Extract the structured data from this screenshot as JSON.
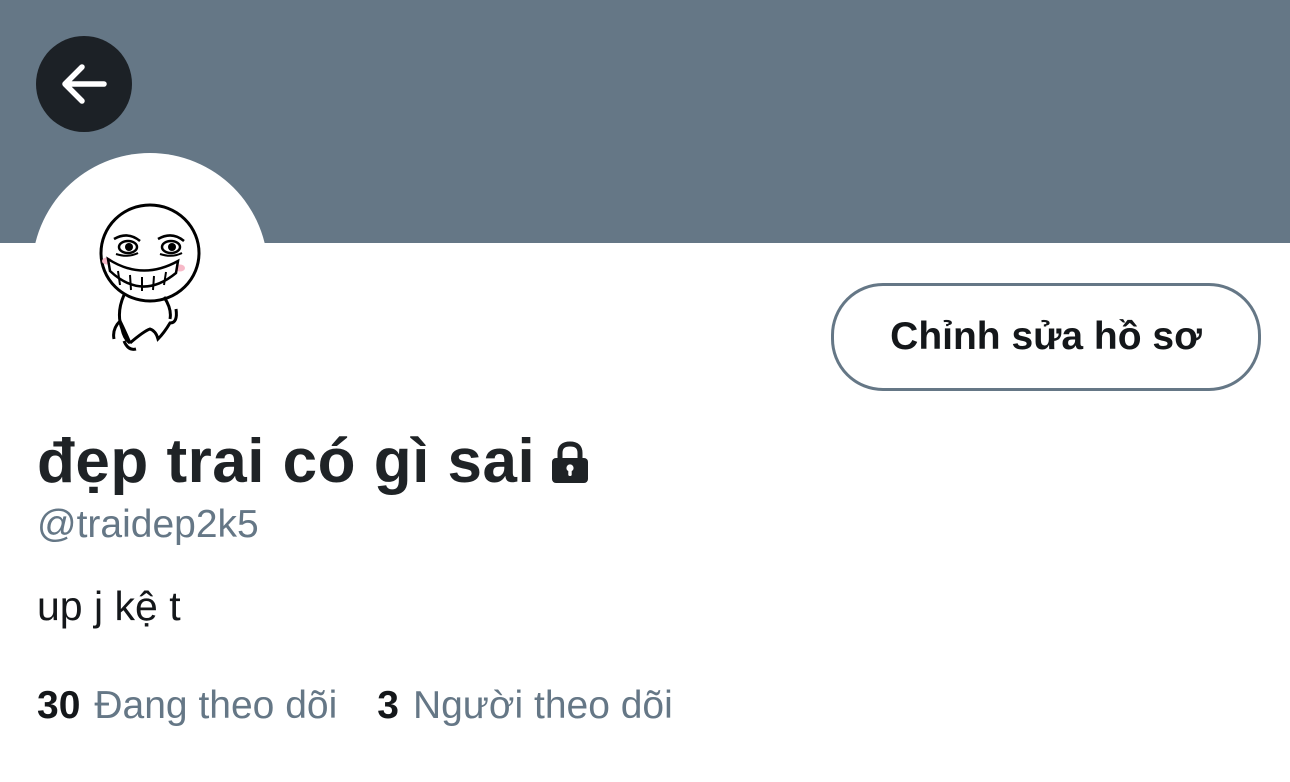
{
  "header": {
    "back_icon": "arrow-left-icon",
    "banner_color": "#657786"
  },
  "profile": {
    "avatar_icon": "cartoon-avatar",
    "edit_button_label": "Chỉnh sửa hồ sơ",
    "display_name": "đẹp trai có gì sai",
    "lock_icon": "lock-icon",
    "handle": "@traidep2k5",
    "bio": "up j kệ t"
  },
  "stats": {
    "following": {
      "count": "30",
      "label": "Đang theo dõi"
    },
    "followers": {
      "count": "3",
      "label": "Người theo dõi"
    }
  }
}
